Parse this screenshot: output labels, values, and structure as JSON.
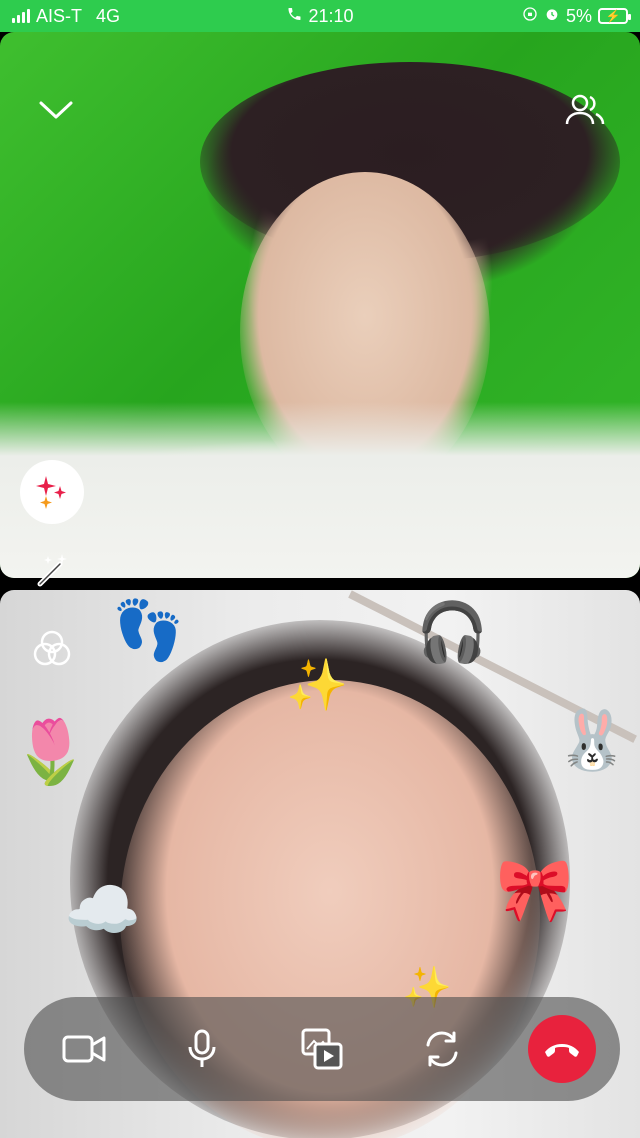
{
  "status_bar": {
    "carrier": "AIS-T",
    "network": "4G",
    "time": "21:10",
    "battery_percent": "5%",
    "bar_color": "#2ecc4e"
  },
  "remote_video": {
    "controls": {
      "minimize_icon": "chevron-down-icon",
      "participants_icon": "people-icon",
      "effects_icon": "sparkle-icon",
      "beauty_icon": "magic-wand-icon"
    }
  },
  "local_video": {
    "controls": {
      "color_filter_icon": "color-overlap-icon"
    },
    "stickers": [
      "👣",
      "✨",
      "🎧",
      "🌷",
      "🐰",
      "☁️",
      "🎀",
      "✨"
    ]
  },
  "call_bar": {
    "buttons": [
      "video-camera-icon",
      "microphone-icon",
      "screen-share-icon",
      "switch-camera-icon",
      "end-call-icon"
    ],
    "end_call_color": "#e8223d"
  }
}
